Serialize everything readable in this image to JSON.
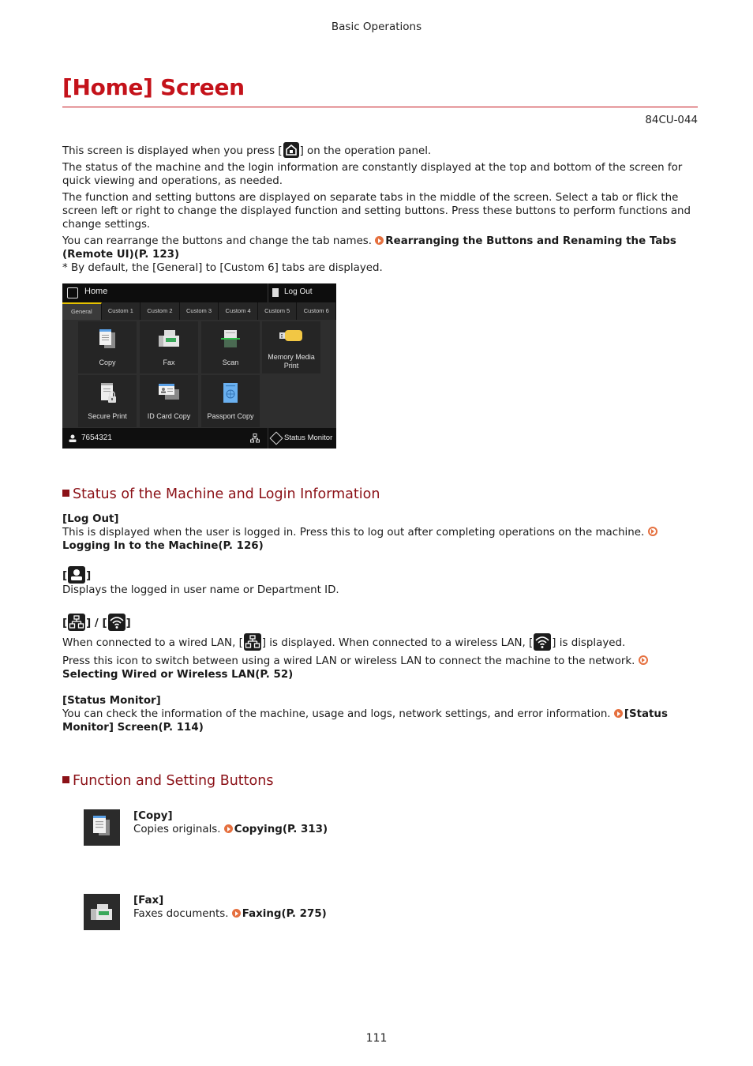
{
  "header": {
    "running_title": "Basic Operations"
  },
  "title": "[Home] Screen",
  "doc_id": "84CU-044",
  "colors": {
    "title_red": "#c4121a",
    "section_maroon": "#8b1117",
    "link_arrow_orange": "#e5703f",
    "tab_active_yellow": "#e6c200"
  },
  "intro": {
    "line1_before": "This screen is displayed when you press [",
    "line1_icon": "home-key-icon",
    "line1_after": "] on the operation panel.",
    "para2": "The status of the machine and the login information are constantly displayed at the top and bottom of the screen for quick viewing and operations, as needed.",
    "para3": "The function and setting buttons are displayed on separate tabs in the middle of the screen. Select a tab or flick the screen left or right to change the displayed function and setting buttons. Press these buttons to perform functions and change settings.",
    "para4_text": "You can rearrange the buttons and change the tab names. ",
    "para4_link": "Rearranging the Buttons and Renaming the Tabs (Remote UI)(P. 123)",
    "note": "* By default, the [General] to [Custom 6] tabs are displayed."
  },
  "device_screen": {
    "home_label": "Home",
    "logout_label": "Log Out",
    "tabs": [
      "General",
      "Custom 1",
      "Custom 2",
      "Custom 3",
      "Custom 4",
      "Custom 5",
      "Custom 6"
    ],
    "active_tab": "General",
    "buttons": [
      {
        "label": "Copy",
        "icon": "copy-icon"
      },
      {
        "label": "Fax",
        "icon": "fax-icon"
      },
      {
        "label": "Scan",
        "icon": "scan-icon"
      },
      {
        "label": "Memory Media Print",
        "icon": "usb-memory-icon"
      },
      {
        "label": "Secure Print",
        "icon": "secure-print-icon"
      },
      {
        "label": "ID Card Copy",
        "icon": "id-card-icon"
      },
      {
        "label": "Passport Copy",
        "icon": "passport-icon"
      }
    ],
    "user_id": "7654321",
    "status_monitor_label": "Status Monitor"
  },
  "sections": {
    "status": {
      "heading": "Status of the Machine and Login Information",
      "logout": {
        "term": "[Log Out]",
        "desc": "This is displayed when the user is logged in. Press this to log out after completing operations on the machine. ",
        "link": "Logging In to the Machine(P. 126)"
      },
      "user": {
        "term_open": "[",
        "term_close": "]",
        "desc": "Displays the logged in user name or Department ID."
      },
      "lan": {
        "term_sep": "] / [",
        "desc1_a": "When connected to a wired LAN, [",
        "desc1_b": "] is displayed. When connected to a wireless LAN, [",
        "desc1_c": "] is displayed.",
        "desc2": "Press this icon to switch between using a wired LAN or wireless LAN to connect the machine to the network. ",
        "link": "Selecting Wired or Wireless LAN(P. 52)"
      },
      "status_monitor": {
        "term": "[Status Monitor]",
        "desc": "You can check the information of the machine, usage and logs, network settings, and error information. ",
        "link": "[Status Monitor] Screen(P. 114)"
      }
    },
    "functions": {
      "heading": "Function and Setting Buttons",
      "items": [
        {
          "term": "[Copy]",
          "desc": "Copies originals. ",
          "link": "Copying(P. 313)",
          "icon": "copy-icon"
        },
        {
          "term": "[Fax]",
          "desc": "Faxes documents. ",
          "link": "Faxing(P. 275)",
          "icon": "fax-icon"
        }
      ]
    }
  },
  "page_number": "111"
}
